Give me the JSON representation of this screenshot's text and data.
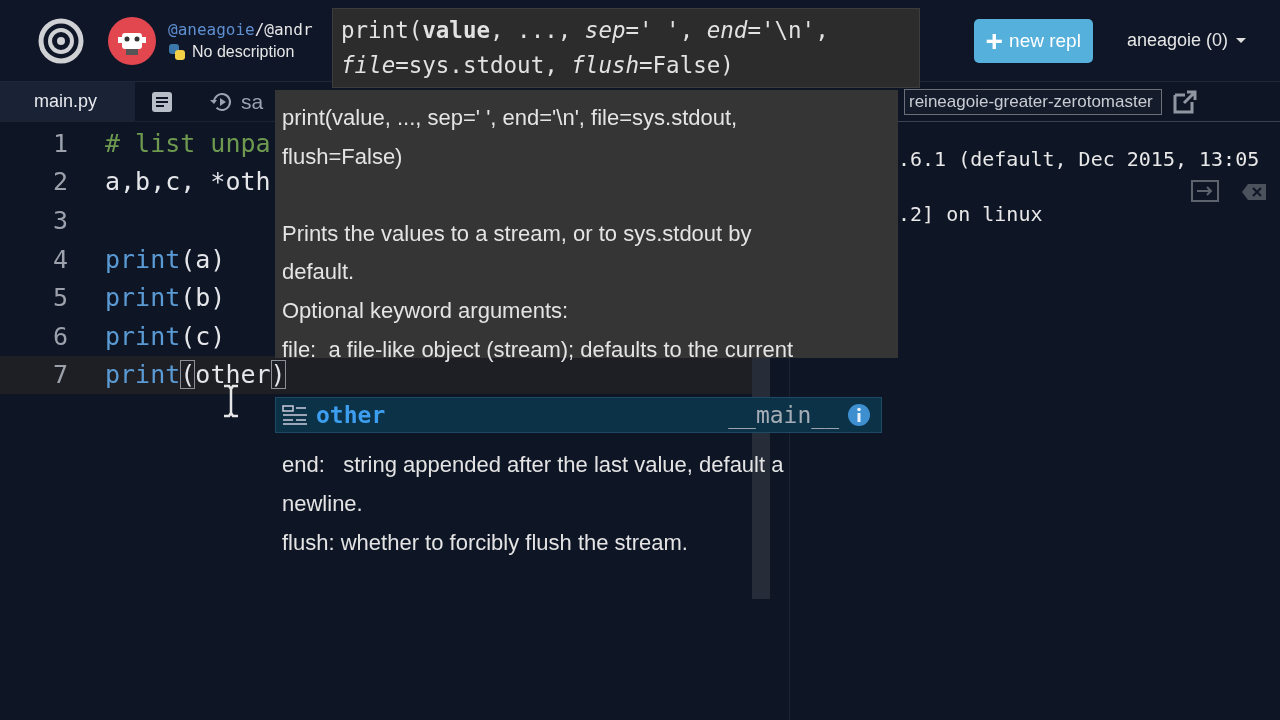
{
  "header": {
    "project": {
      "owner": "@aneagoie",
      "separator": "/",
      "name": "@andr"
    },
    "description": "No description",
    "new_button": {
      "icon": "+",
      "label": "new repl"
    },
    "user_menu": "aneagoie (0)"
  },
  "tabs": [
    {
      "label": "main.py",
      "selected": true
    }
  ],
  "toolbar": [
    {
      "kind": "document"
    },
    {
      "kind": "history",
      "label": "sa"
    }
  ],
  "url_field": {
    "value": "reineagoie-greater-zerotomaster"
  },
  "editor": {
    "lines": [
      {
        "number": "1",
        "current": false,
        "tokens": [
          {
            "kind": "comment",
            "text": "# list unpa"
          }
        ]
      },
      {
        "number": "2",
        "current": false,
        "tokens": [
          {
            "kind": "plain",
            "text": "a,b,c, *oth"
          }
        ]
      },
      {
        "number": "3",
        "current": false
      },
      {
        "number": "4",
        "current": false,
        "tokens": [
          {
            "kind": "builtin",
            "text": "print"
          },
          {
            "kind": "plain",
            "text": "(a)"
          }
        ]
      },
      {
        "number": "5",
        "current": false,
        "tokens": [
          {
            "kind": "builtin",
            "text": "print"
          },
          {
            "kind": "plain",
            "text": "(b)"
          }
        ]
      },
      {
        "number": "6",
        "current": false,
        "tokens": [
          {
            "kind": "builtin",
            "text": "print"
          },
          {
            "kind": "plain",
            "text": "(c)"
          }
        ]
      },
      {
        "number": "7",
        "current": true,
        "tokens": [
          {
            "kind": "builtin",
            "text": "print"
          },
          {
            "kind": "bracket",
            "text": "("
          },
          {
            "kind": "plain",
            "text": "other"
          },
          {
            "kind": "bracket",
            "text": ")"
          }
        ]
      }
    ]
  },
  "console": {
    "lines": [
      ".6.1 (default, Dec 2015, 13:05",
      ".2] on linux"
    ]
  },
  "signature_tip": {
    "lines": [
      "print(**value**, ..., *sep*=' ', *end*='\\n',",
      "*file*=sys.stdout, *flush*=False)"
    ]
  },
  "doc_tip": {
    "blocks": [
      {
        "lines": [
          "print(value, ..., sep=' ', end='\\n', file=sys.stdout,",
          "flush=False)"
        ]
      },
      {
        "lines": [
          "Prints the values to a stream, or to sys.stdout by",
          "default.",
          "Optional keyword arguments:",
          "file:  a file-like object (stream); defaults to the current"
        ]
      },
      {
        "lines": [
          "end:   string appended after the last value, default a",
          "newline.",
          "flush: whether to forcibly flush the stream."
        ]
      }
    ]
  },
  "suggestions": [
    {
      "label": "other",
      "module": "__main__",
      "selected": true
    }
  ]
}
